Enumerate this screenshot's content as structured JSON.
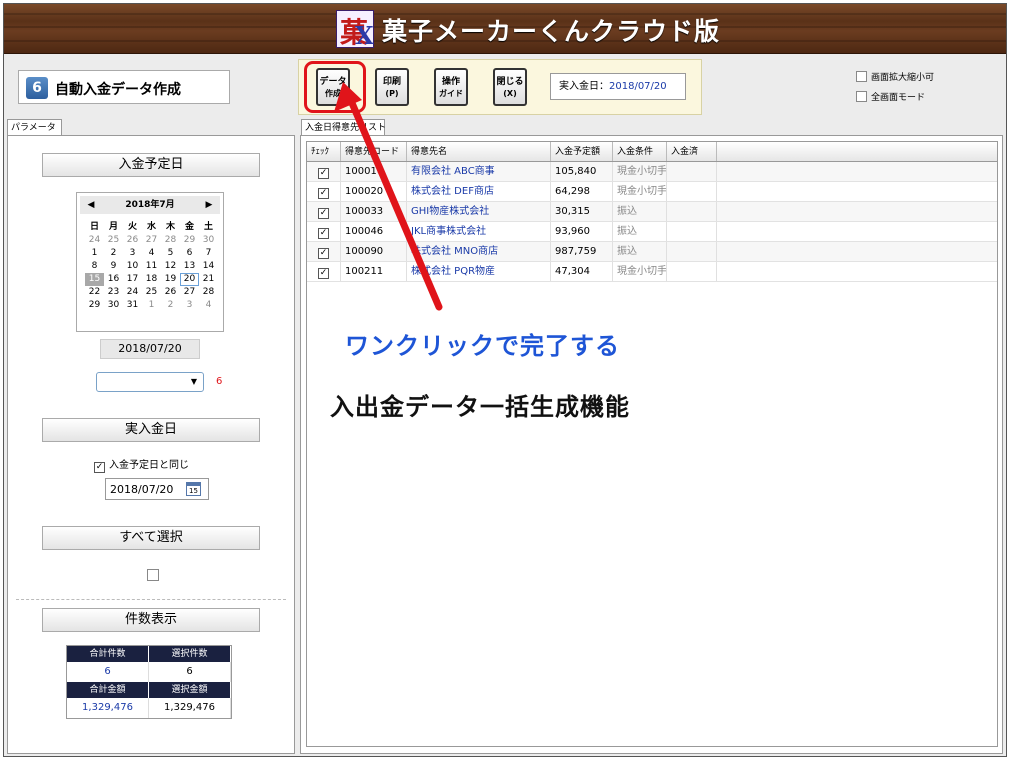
{
  "app": {
    "title": "菓子メーカーくんクラウド版",
    "logo_text": "菓子メーカーくん"
  },
  "screen": {
    "number": "6",
    "title": "自動入金データ作成"
  },
  "toolbar": {
    "data_create": {
      "label": "データ",
      "sub": "作成"
    },
    "print": {
      "label": "印刷",
      "sub": "(P)"
    },
    "guide": {
      "label": "操作",
      "sub": "ガイド"
    },
    "close": {
      "label": "閉じる",
      "sub": "(X)"
    },
    "pay_date_label": "実入金日：",
    "pay_date_value": "2018/07/20"
  },
  "options": {
    "zoom_label": "画面拡大縮小可",
    "fullscreen_label": "全画面モード"
  },
  "left": {
    "tab": "パラメータ",
    "scheduled_title": "入金予定日",
    "calendar": {
      "month_label": "2018年7月",
      "prev": "◀",
      "next": "▶",
      "dow": [
        "日",
        "月",
        "火",
        "水",
        "木",
        "金",
        "土"
      ],
      "weeks": [
        [
          "24",
          "25",
          "26",
          "27",
          "28",
          "29",
          "30"
        ],
        [
          "1",
          "2",
          "3",
          "4",
          "5",
          "6",
          "7"
        ],
        [
          "8",
          "9",
          "10",
          "11",
          "12",
          "13",
          "14"
        ],
        [
          "15",
          "16",
          "17",
          "18",
          "19",
          "20",
          "21"
        ],
        [
          "22",
          "23",
          "24",
          "25",
          "26",
          "27",
          "28"
        ],
        [
          "29",
          "30",
          "31",
          "1",
          "2",
          "3",
          "4"
        ]
      ]
    },
    "selected_date": "2018/07/20",
    "combo_arrow": "▼",
    "combo_count": "6",
    "actual_title": "実入金日",
    "same_as_scheduled": "入金予定日と同じ",
    "actual_date": "2018/07/20",
    "calendar_icon_text": "15",
    "select_all_title": "すべて選択",
    "count_title": "件数表示",
    "counts": {
      "total_count_label": "合計件数",
      "selected_count_label": "選択件数",
      "total_count": "6",
      "selected_count": "6",
      "total_amount_label": "合計金額",
      "selected_amount_label": "選択金額",
      "total_amount": "1,329,476",
      "selected_amount": "1,329,476"
    }
  },
  "right": {
    "tab": "入金日得意先リスト",
    "columns": [
      "ﾁｪｯｸ",
      "得意先コード",
      "得意先名",
      "入金予定額",
      "入金条件",
      "入金済"
    ],
    "rows": [
      {
        "checked": "✓",
        "code": "100016",
        "name": "有限会社 ABC商事",
        "amount": "105,840",
        "cond": "現金小切手",
        "done": ""
      },
      {
        "checked": "✓",
        "code": "100020",
        "name": "株式会社 DEF商店",
        "amount": "64,298",
        "cond": "現金小切手",
        "done": ""
      },
      {
        "checked": "✓",
        "code": "100033",
        "name": "GHI物産株式会社",
        "amount": "30,315",
        "cond": "振込",
        "done": ""
      },
      {
        "checked": "✓",
        "code": "100046",
        "name": "JKL商事株式会社",
        "amount": "93,960",
        "cond": "振込",
        "done": ""
      },
      {
        "checked": "✓",
        "code": "100090",
        "name": "株式会社 MNO商店",
        "amount": "987,759",
        "cond": "振込",
        "done": ""
      },
      {
        "checked": "✓",
        "code": "100211",
        "name": "株式会社 PQR物産",
        "amount": "47,304",
        "cond": "現金小切手",
        "done": ""
      }
    ]
  },
  "annotation": {
    "callout1": "ワンクリックで完了する",
    "callout2": "入出金データ一括生成機能",
    "color": "#e0141a"
  }
}
